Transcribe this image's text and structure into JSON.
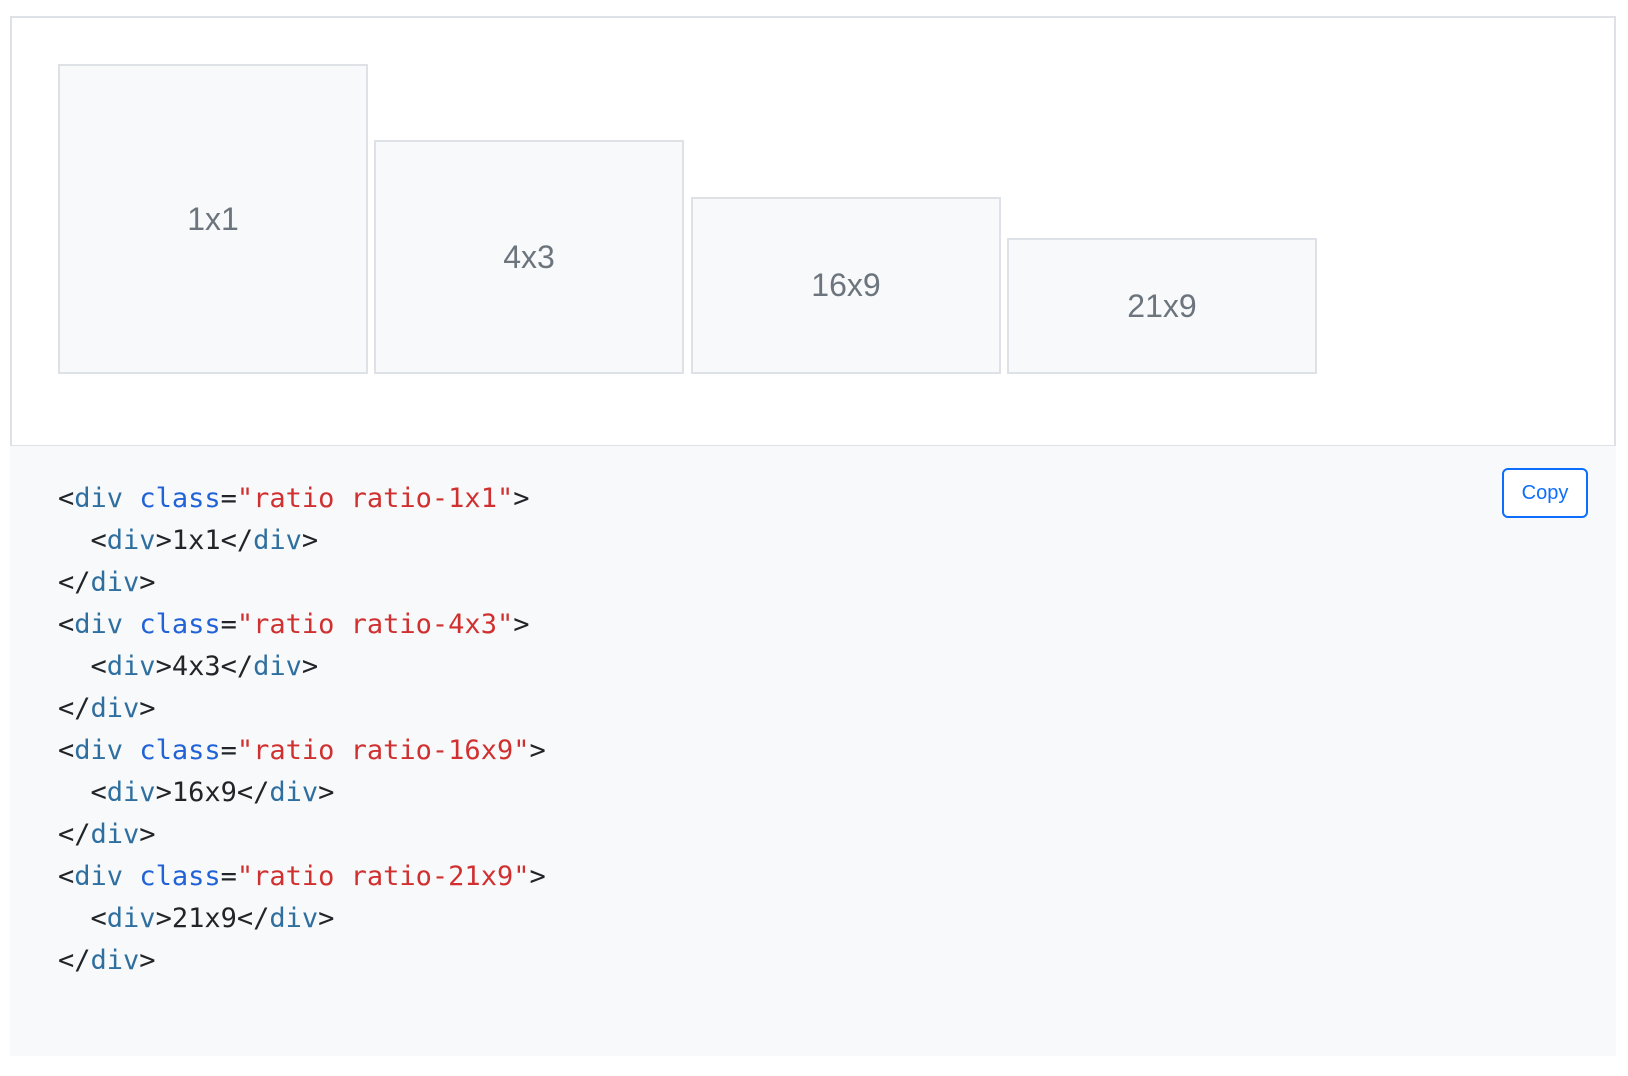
{
  "example": {
    "boxes": [
      {
        "label": "1x1"
      },
      {
        "label": "4x3"
      },
      {
        "label": "16x9"
      },
      {
        "label": "21x9"
      }
    ]
  },
  "code": {
    "copy_label": "Copy",
    "blocks": [
      {
        "open_tag": "div",
        "attr": "class",
        "value": "\"ratio ratio-1x1\"",
        "inner": "1x1"
      },
      {
        "open_tag": "div",
        "attr": "class",
        "value": "\"ratio ratio-4x3\"",
        "inner": "4x3"
      },
      {
        "open_tag": "div",
        "attr": "class",
        "value": "\"ratio ratio-16x9\"",
        "inner": "16x9"
      },
      {
        "open_tag": "div",
        "attr": "class",
        "value": "\"ratio ratio-21x9\"",
        "inner": "21x9"
      }
    ]
  }
}
